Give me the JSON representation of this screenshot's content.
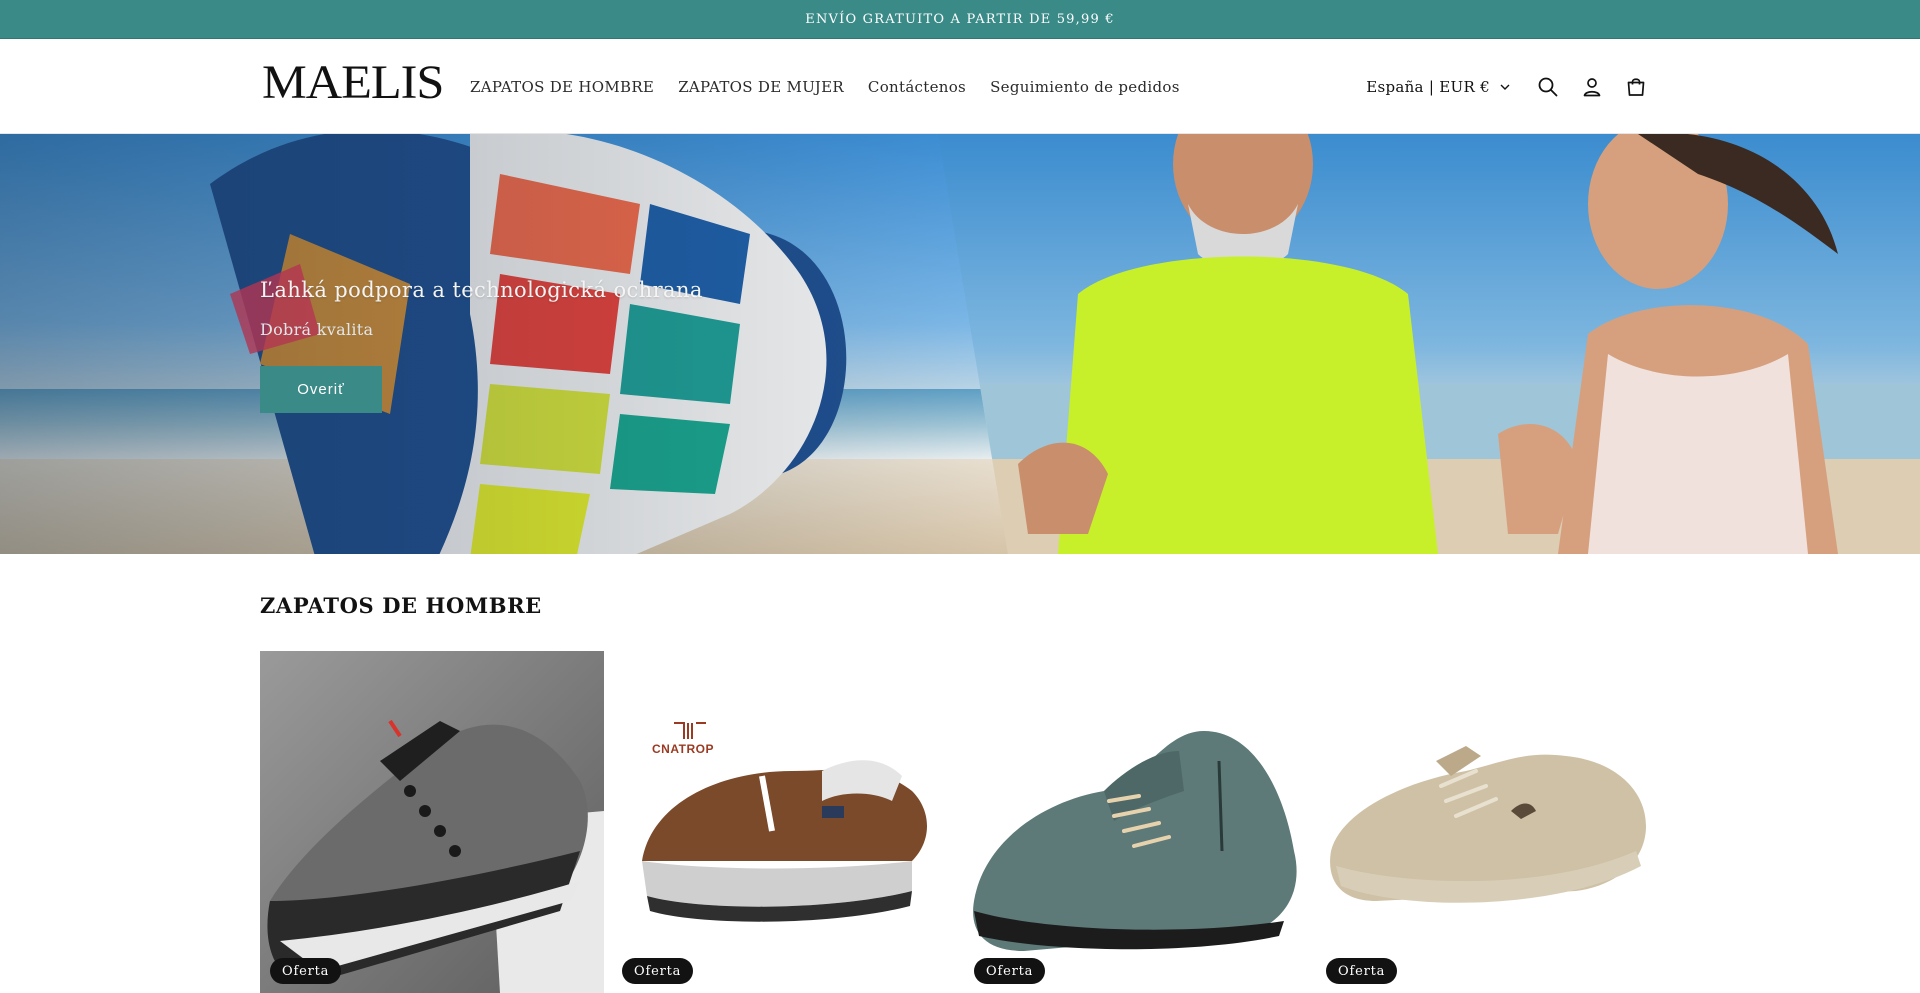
{
  "announcement": {
    "text": "ENVÍO GRATUITO A PARTIR DE 59,99 €"
  },
  "header": {
    "logo_text": "MAELIS",
    "nav": [
      {
        "label": "ZAPATOS DE HOMBRE"
      },
      {
        "label": "ZAPATOS DE MUJER"
      },
      {
        "label": "Contáctenos"
      },
      {
        "label": "Seguimiento de pedidos"
      }
    ],
    "locale_label": "España | EUR €",
    "icons": [
      "search-icon",
      "account-icon",
      "cart-icon",
      "chevron-down-icon"
    ]
  },
  "hero": {
    "heading": "Ľahká podpora a technologická ochrana",
    "subheading": "Dobrá kvalita",
    "button_label": "Overiť"
  },
  "section": {
    "title": "ZAPATOS DE HOMBRE",
    "products": [
      {
        "badge": "Oferta",
        "brand_mark": ""
      },
      {
        "badge": "Oferta",
        "brand_mark": "CNATROP"
      },
      {
        "badge": "Oferta",
        "brand_mark": ""
      },
      {
        "badge": "Oferta",
        "brand_mark": ""
      }
    ]
  },
  "colors": {
    "accent": "#3a8a88",
    "badge_bg": "#121212",
    "text": "#121212"
  }
}
